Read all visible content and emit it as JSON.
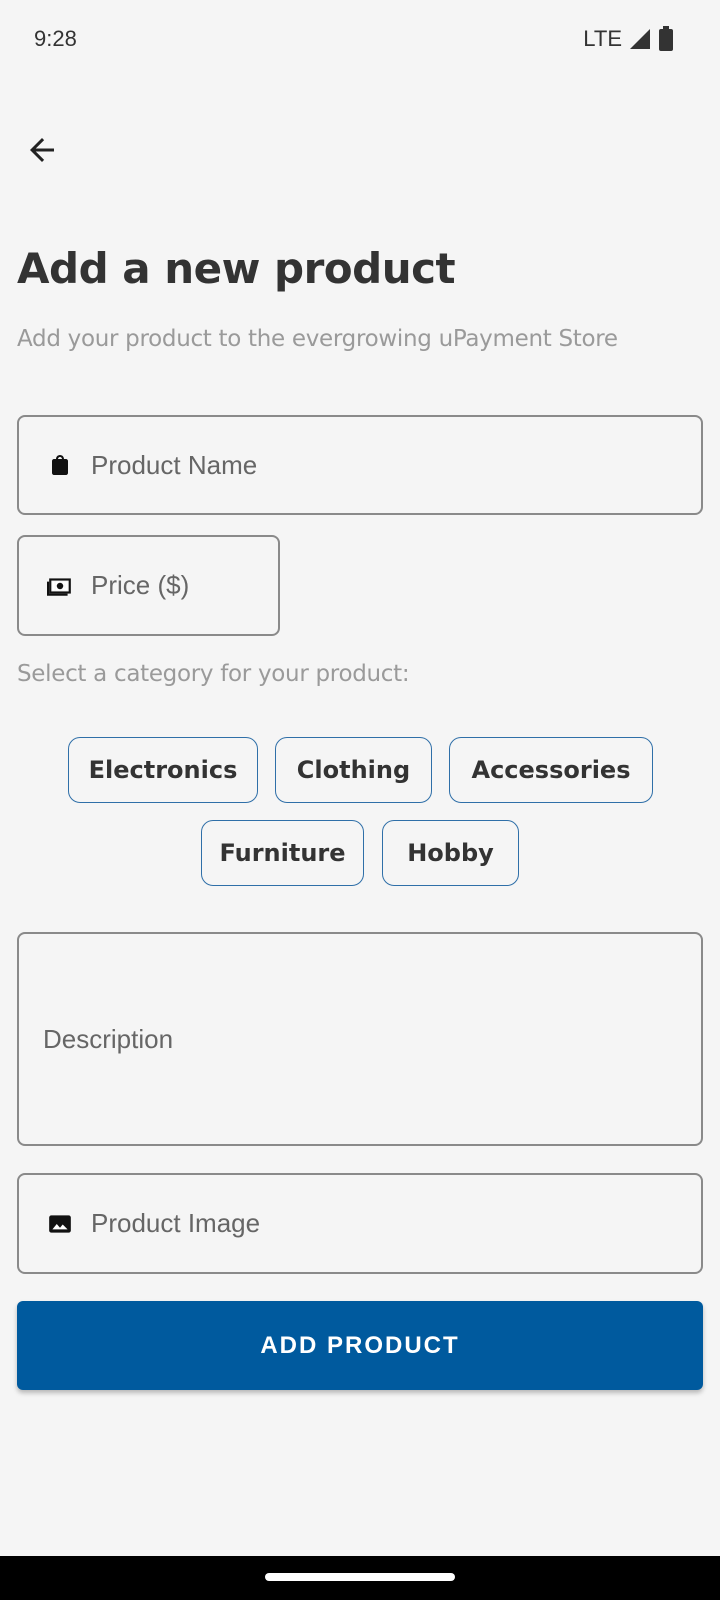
{
  "status_bar": {
    "time": "9:28",
    "network": "LTE"
  },
  "header": {
    "title": "Add a new product",
    "subtitle": "Add your product to the evergrowing uPayment Store"
  },
  "form": {
    "name_placeholder": "Product Name",
    "price_placeholder": "Price ($)",
    "category_label": "Select a category for your product:",
    "categories": [
      "Electronics",
      "Clothing",
      "Accessories",
      "Furniture",
      "Hobby"
    ],
    "description_placeholder": "Description",
    "image_placeholder": "Product Image",
    "submit_label": "ADD PRODUCT"
  },
  "icons": {
    "back": "arrow-left-icon",
    "name": "shopping-bag-icon",
    "price": "money-icon",
    "image": "image-icon"
  },
  "colors": {
    "accent": "#005a9e",
    "chip_border": "#2f6fa8",
    "background": "#f5f5f5"
  }
}
